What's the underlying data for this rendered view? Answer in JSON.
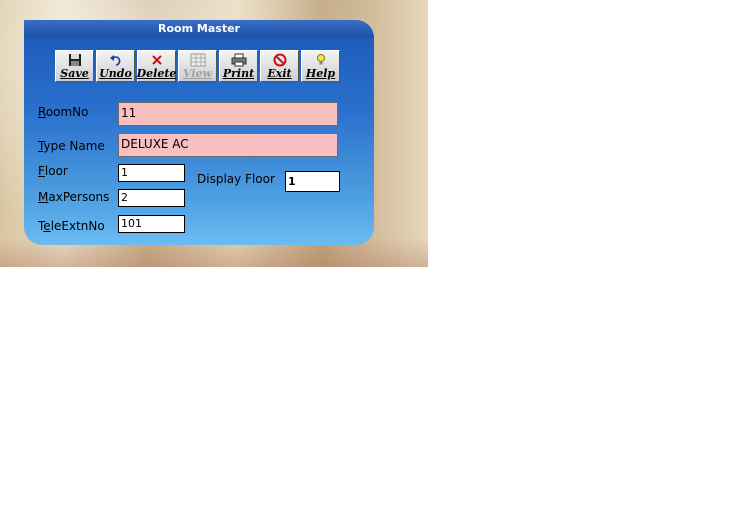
{
  "window": {
    "title": "Room Master"
  },
  "toolbar": {
    "buttons": [
      {
        "label": "Save",
        "icon": "floppy-disk-icon"
      },
      {
        "label": "Undo",
        "icon": "undo-arrow-icon"
      },
      {
        "label": "Delete",
        "icon": "red-x-icon"
      },
      {
        "label": "View",
        "icon": "grid-table-icon"
      },
      {
        "label": "Print",
        "icon": "printer-icon"
      },
      {
        "label": "Exit",
        "icon": "no-entry-icon"
      },
      {
        "label": "Help",
        "icon": "lightbulb-icon"
      }
    ]
  },
  "form": {
    "roomno": {
      "label_first": "R",
      "label_rest": "oomNo",
      "value": "11"
    },
    "typename": {
      "label_first": "T",
      "label_rest": "ype Name",
      "value": "DELUXE AC"
    },
    "floor": {
      "label_first": "F",
      "label_rest": "loor",
      "value": "1"
    },
    "maxpersons": {
      "label_first": "M",
      "label_rest": "axPersons",
      "value": "2"
    },
    "teleextn": {
      "label_pre": "T",
      "label_first": "e",
      "label_rest": "leExtnNo",
      "value": "101"
    },
    "displayfloor": {
      "label": "Display Floor",
      "value": "1"
    }
  }
}
